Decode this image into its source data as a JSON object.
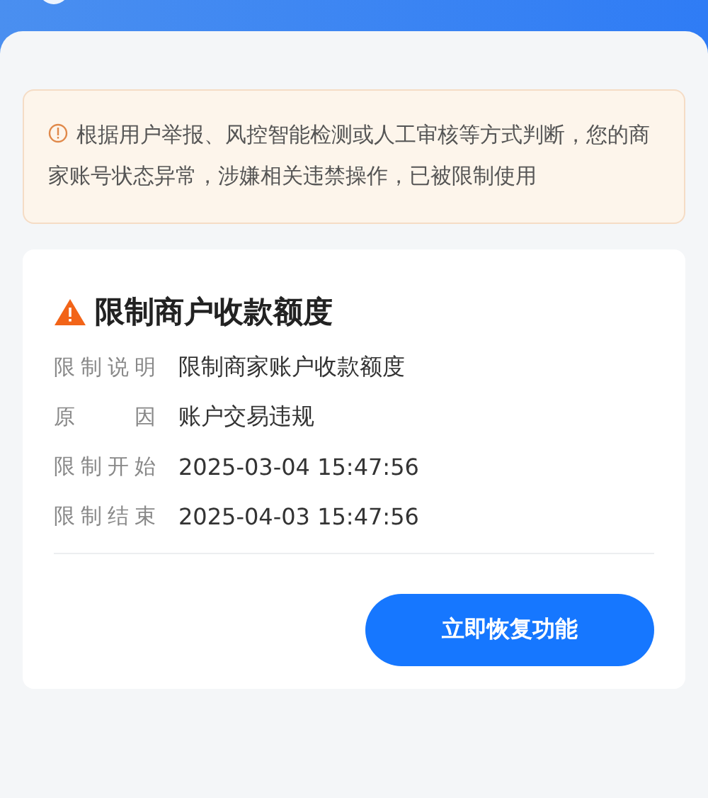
{
  "notice": {
    "text": "根据用户举报、风控智能检测或人工审核等方式判断，您的商家账号状态异常，涉嫌相关违禁操作，已被限制使用"
  },
  "card": {
    "title": "限制商户收款额度",
    "rows": [
      {
        "label": "限制说明",
        "value": "限制商家账户收款额度"
      },
      {
        "label": "原因",
        "value": "账户交易违规"
      },
      {
        "label": "限制开始",
        "value": "2025-03-04 15:47:56"
      },
      {
        "label": "限制结束",
        "value": "2025-04-03 15:47:56"
      }
    ],
    "button": "立即恢复功能"
  }
}
